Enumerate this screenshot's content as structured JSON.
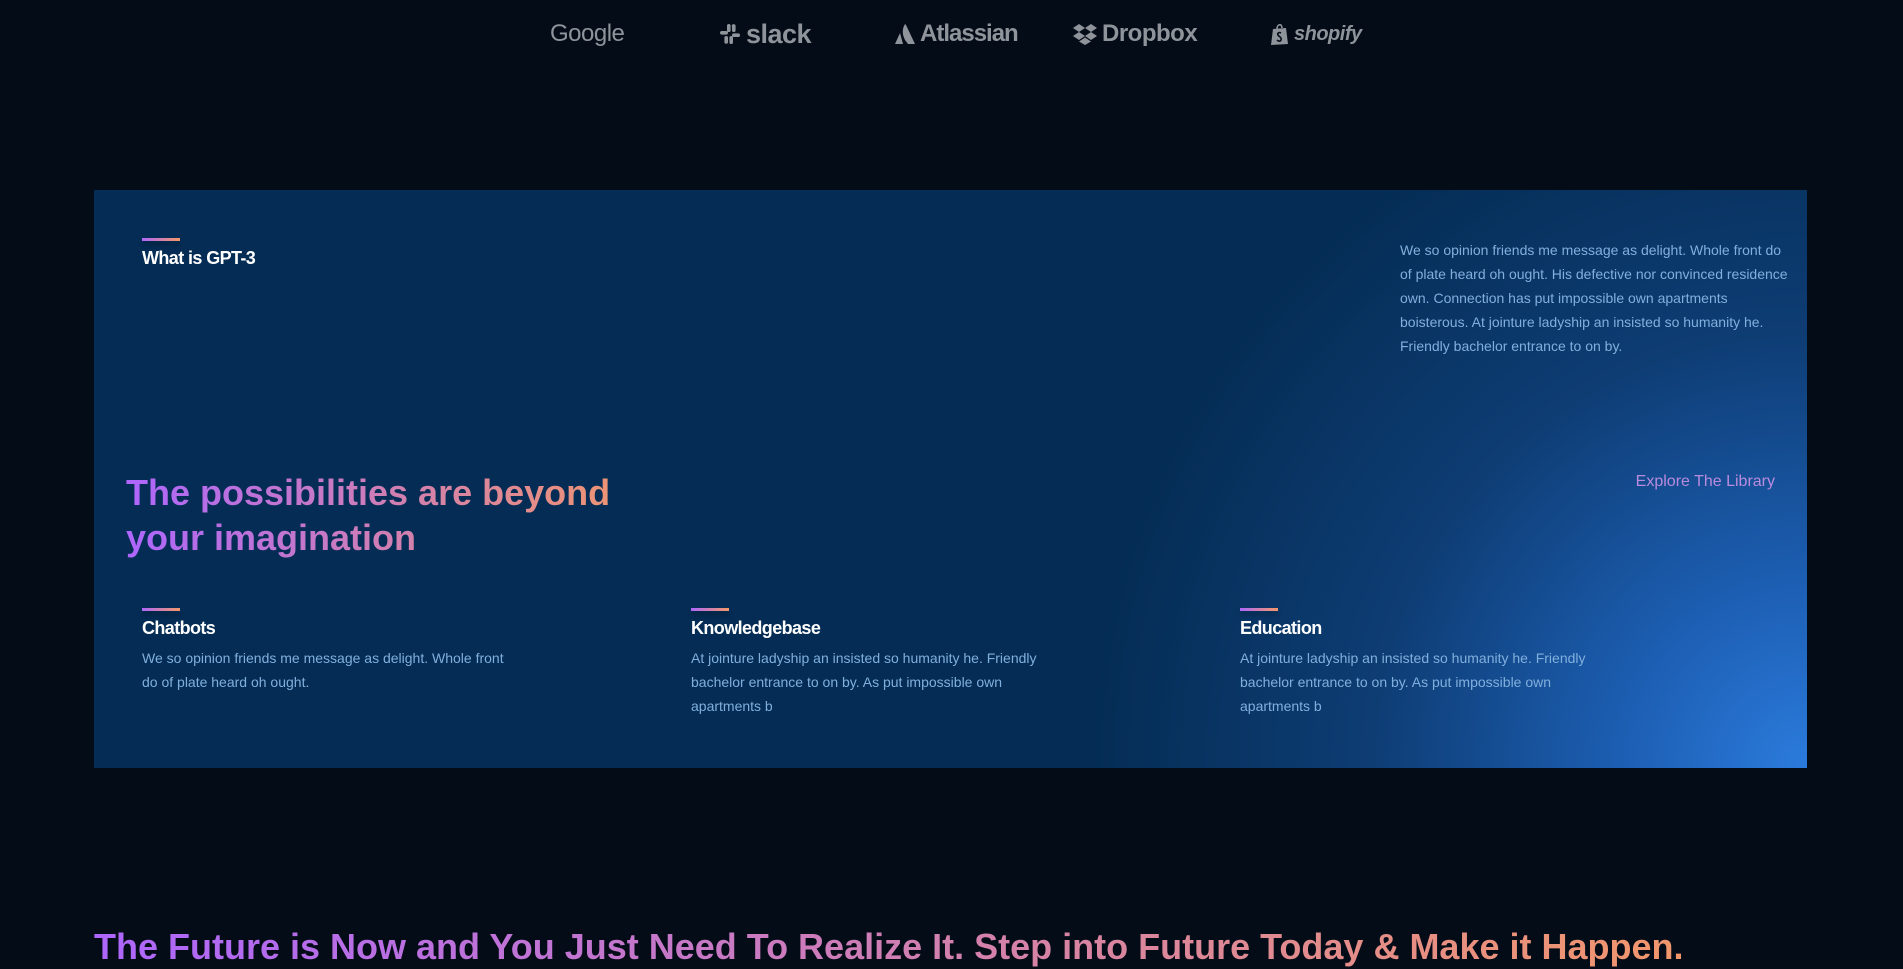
{
  "brands": [
    {
      "name": "Google",
      "icon": "google-logo"
    },
    {
      "name": "slack",
      "icon": "slack-logo"
    },
    {
      "name": "Atlassian",
      "icon": "atlassian-logo"
    },
    {
      "name": "Dropbox",
      "icon": "dropbox-logo"
    },
    {
      "name": "shopify",
      "icon": "shopify-logo"
    }
  ],
  "whatgpt": {
    "feature": {
      "title": "What is GPT-3",
      "text": "We so opinion friends me message as delight. Whole front do of plate heard oh ought. His defective nor convinced residence own. Connection has put impossible own apartments boisterous. At jointure ladyship an insisted so humanity he. Friendly bachelor entrance to on by."
    },
    "heading": "The possibilities are beyond your imagination",
    "explore_link": "Explore The Library",
    "features": [
      {
        "title": "Chatbots",
        "text": "We so opinion friends me message as delight. Whole front do of plate heard oh ought."
      },
      {
        "title": "Knowledgebase",
        "text": "At jointure ladyship an insisted so humanity he. Friendly bachelor entrance to on by. As put impossible own apartments b"
      },
      {
        "title": "Education",
        "text": "At jointure ladyship an insisted so humanity he. Friendly bachelor entrance to on by. As put impossible own apartments b"
      }
    ]
  },
  "future": {
    "heading": "The Future is Now and You Just Need To Realize It. Step into Future Today & Make it Happen."
  },
  "colors": {
    "background": "#040c18",
    "section_bg": "#042c54",
    "accent_gradient_start": "#ae67fa",
    "accent_gradient_end": "#f49867",
    "body_text": "#81afdd",
    "logo_gray": "#8f949b"
  }
}
